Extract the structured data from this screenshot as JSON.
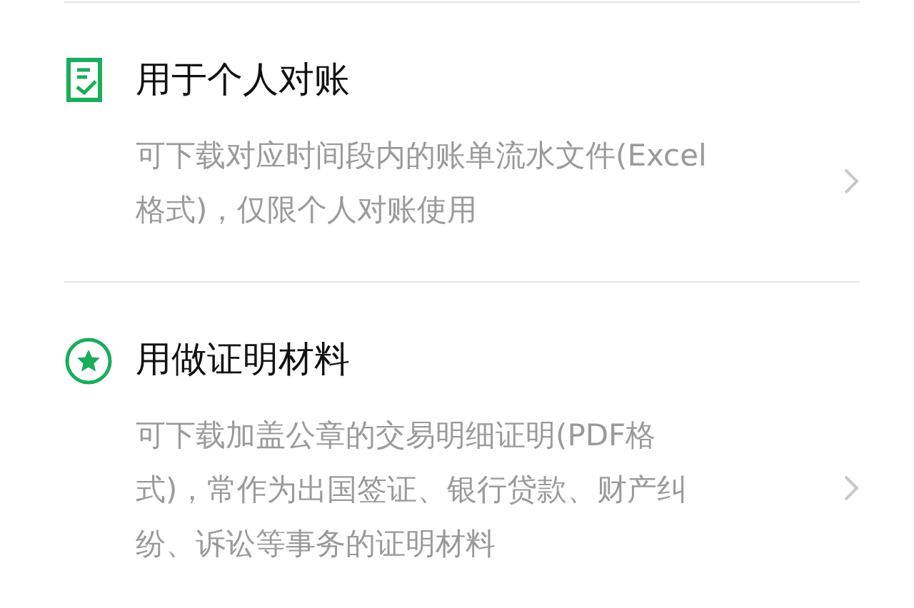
{
  "options": [
    {
      "kind": "document",
      "title": "用于个人对账",
      "description": [
        "可下载对应时间段内的账单流水文件(Excel",
        "格式)，仅限个人对账使用"
      ]
    },
    {
      "kind": "star",
      "title": "用做证明材料",
      "description": [
        "可下载加盖公章的交易明细证明(PDF格",
        "式)，常作为出国签证、银行贷款、财产纠",
        "纷、诉讼等事务的证明材料"
      ]
    }
  ]
}
